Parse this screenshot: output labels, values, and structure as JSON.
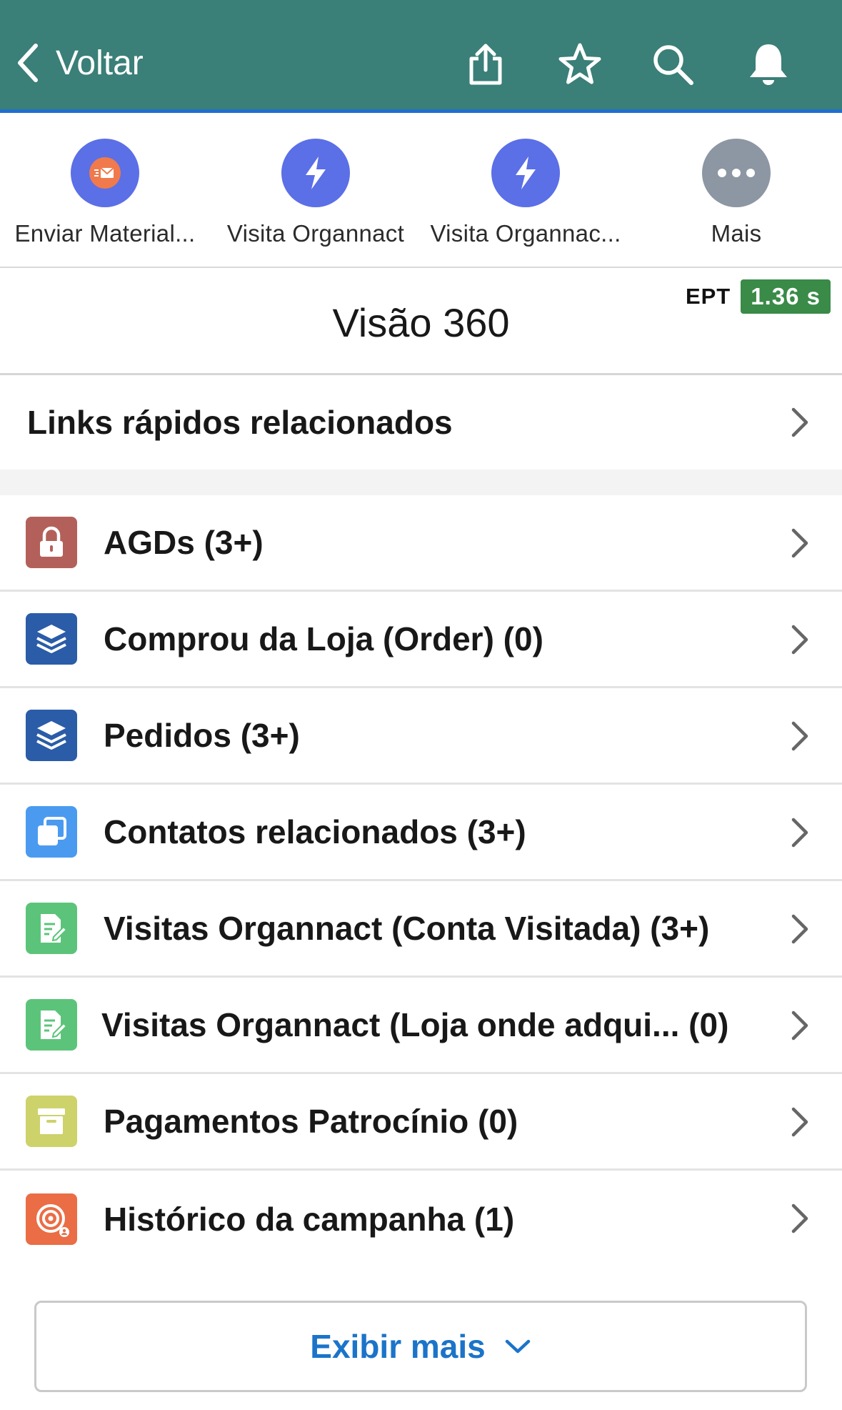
{
  "header": {
    "back_label": "Voltar",
    "icons": [
      "share-icon",
      "star-icon",
      "search-icon",
      "bell-icon"
    ]
  },
  "actions": [
    {
      "label": "Enviar Material...",
      "color": "#5b6fe6",
      "icon": "email-send-icon"
    },
    {
      "label": "Visita Organnact",
      "color": "#5b6fe6",
      "icon": "lightning-icon"
    },
    {
      "label": "Visita Organnac...",
      "color": "#5b6fe6",
      "icon": "lightning-icon"
    },
    {
      "label": "Mais",
      "color": "#8d96a3",
      "icon": "more-icon"
    }
  ],
  "section": {
    "title": "Visão 360",
    "ept_label": "EPT",
    "ept_value": "1.36 s"
  },
  "quick_links": {
    "label": "Links rápidos relacionados"
  },
  "related_lists": [
    {
      "label": "AGDs (3+)",
      "color": "#b4605a",
      "icon": "lock-icon"
    },
    {
      "label": "Comprou da Loja (Order) (0)",
      "color": "#2a5ca8",
      "icon": "stack-icon"
    },
    {
      "label": "Pedidos (3+)",
      "color": "#2a5ca8",
      "icon": "stack-icon"
    },
    {
      "label": "Contatos relacionados (3+)",
      "color": "#4a9bf0",
      "icon": "contacts-icon"
    },
    {
      "label": "Visitas Organnact (Conta Visitada) (3+)",
      "color": "#5cc47a",
      "icon": "note-edit-icon"
    },
    {
      "label": "Visitas Organnact (Loja onde adqui... (0)",
      "color": "#5cc47a",
      "icon": "note-edit-icon"
    },
    {
      "label": "Pagamentos Patrocínio (0)",
      "color": "#cdd26a",
      "icon": "archive-icon"
    },
    {
      "label": "Histórico da campanha (1)",
      "color": "#ea6d45",
      "icon": "target-icon"
    }
  ],
  "footer": {
    "show_more_label": "Exibir mais"
  }
}
